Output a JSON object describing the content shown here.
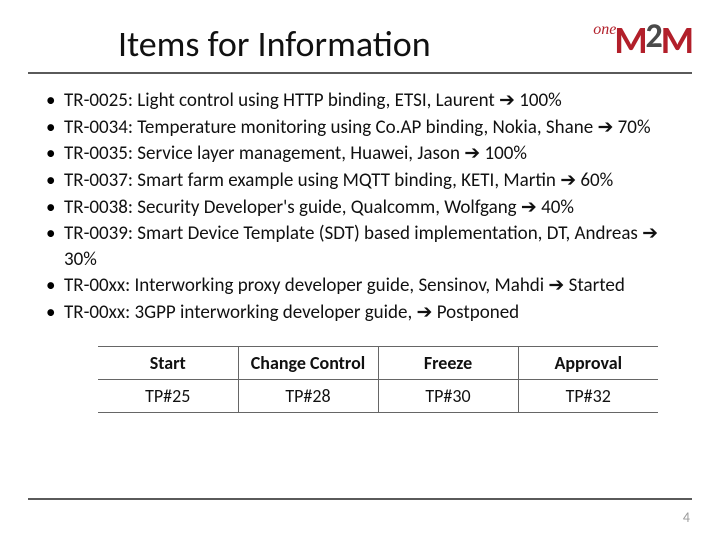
{
  "header": {
    "title": "Items for Information",
    "logo": {
      "one": "one",
      "m1": "M",
      "two": "2",
      "m2": "M"
    }
  },
  "items": [
    "TR-0025: Light control using HTTP binding, ETSI, Laurent ➔ 100%",
    "TR-0034: Temperature monitoring using Co.AP binding, Nokia, Shane ➔ 70%",
    "TR-0035: Service layer management, Huawei, Jason ➔ 100%",
    "TR-0037: Smart farm example using MQTT binding, KETI, Martin ➔ 60%",
    "TR-0038: Security Developer's guide, Qualcomm, Wolfgang ➔ 40%",
    "TR-0039: Smart Device Template (SDT) based implementation, DT, Andreas ➔ 30%",
    "TR-00xx: Interworking proxy developer guide, Sensinov, Mahdi ➔ Started",
    "TR-00xx: 3GPP interworking developer guide, ➔ Postponed"
  ],
  "table": {
    "headers": [
      "Start",
      "Change Control",
      "Freeze",
      "Approval"
    ],
    "row": [
      "TP#25",
      "TP#28",
      "TP#30",
      "TP#32"
    ]
  },
  "page_number": "4"
}
